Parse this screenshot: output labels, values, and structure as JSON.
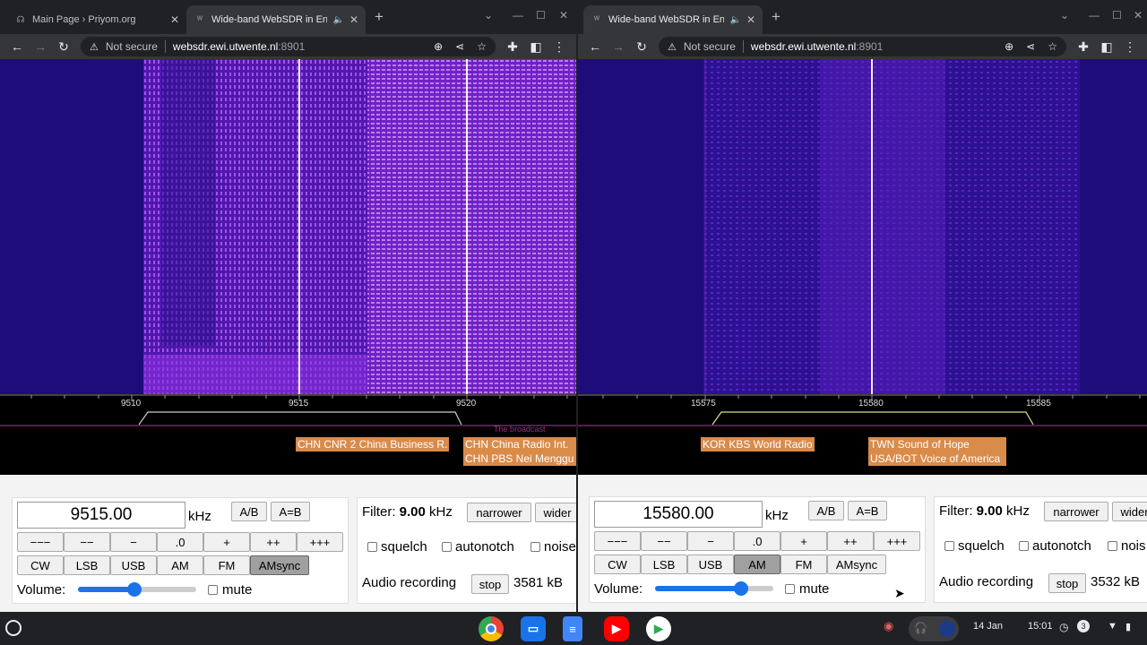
{
  "left": {
    "tabs": [
      {
        "title": "Main Page › Priyom.org",
        "favicon": "priyom-icon"
      },
      {
        "title": "Wide-band WebSDR in Ensche",
        "favicon": "websdr-icon",
        "audio": true
      }
    ],
    "omnibox": {
      "security": "Not secure",
      "host": "websdr.ewi.utwente.nl",
      "port": ":8901"
    },
    "scale": {
      "ticks": [
        "9510",
        "9515",
        "9520"
      ],
      "stations": [
        "CHN CNR 2 China Business R.",
        "CHN China Radio Int.",
        "CHN PBS Nei Menggu"
      ],
      "faint": "The broadcast"
    },
    "frequency": "9515.00",
    "mode_selected": "AMsync",
    "filter_value": "9.00",
    "filter_btn_right": "wider",
    "noise_label": "noise",
    "recording_size": "3581 kB"
  },
  "right": {
    "tabs": [
      {
        "title": "Wide-band WebSDR in Ensche",
        "favicon": "websdr-icon",
        "audio": true
      }
    ],
    "omnibox": {
      "security": "Not secure",
      "host": "websdr.ewi.utwente.nl",
      "port": ":8901"
    },
    "scale": {
      "ticks": [
        "15575",
        "15580",
        "15585"
      ],
      "stations": [
        "KOR KBS World Radio",
        "TWN Sound of Hope",
        "USA/BOT Voice of America"
      ]
    },
    "frequency": "15580.00",
    "mode_selected": "AM",
    "filter_value": "9.00",
    "filter_btn_right": "wider",
    "noise_label": "nois",
    "recording_size": "3532 kB"
  },
  "common": {
    "unit": "kHz",
    "ab": "A/B",
    "aeqb": "A=B",
    "steps": [
      "−−−",
      "−−",
      "−",
      ".0",
      "+",
      "++",
      "+++"
    ],
    "modes": [
      "CW",
      "LSB",
      "USB",
      "AM",
      "FM",
      "AMsync"
    ],
    "volume_label": "Volume:",
    "volume_level": 0.48,
    "mute": "mute",
    "filter_label": "Filter:",
    "filter_unit": "kHz",
    "narrower": "narrower",
    "squelch": "squelch",
    "autonotch": "autonotch",
    "audio_recording": "Audio recording",
    "stop": "stop"
  },
  "taskbar": {
    "apps": [
      "chrome-icon",
      "files-icon",
      "docs-icon",
      "youtube-icon",
      "play-store-icon"
    ],
    "date": "14 Jan",
    "time": "15:01",
    "notif_count": "3"
  },
  "colors": {
    "wf_bg": "#1e0c7a",
    "signal": "#b040ff",
    "station_label": "#d98b4a"
  }
}
